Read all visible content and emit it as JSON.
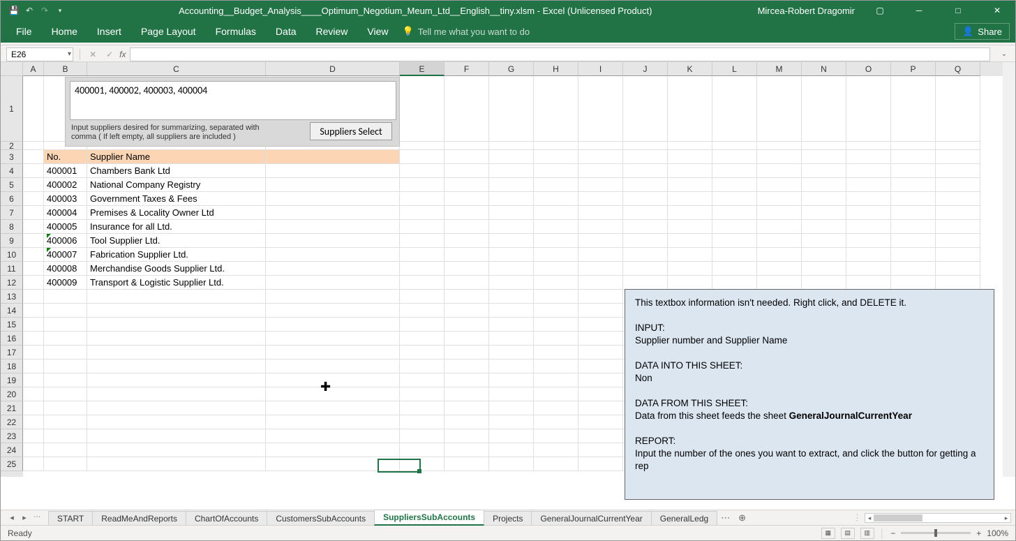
{
  "titlebar": {
    "title": "Accounting__Budget_Analysis____Optimum_Negotium_Meum_Ltd__English__tiny.xlsm  -  Excel (Unlicensed Product)",
    "user": "Mircea-Robert Dragomir"
  },
  "ribbon": {
    "tabs": [
      "File",
      "Home",
      "Insert",
      "Page Layout",
      "Formulas",
      "Data",
      "Review",
      "View"
    ],
    "tell_me": "Tell me what you want to do",
    "share": "Share"
  },
  "name_box": "E26",
  "columns": [
    "A",
    "B",
    "C",
    "D",
    "E",
    "F",
    "G",
    "H",
    "I",
    "J",
    "K",
    "L",
    "M",
    "N",
    "O",
    "P",
    "Q"
  ],
  "row_count": 25,
  "input_panel": {
    "value": "400001, 400002, 400003, 400004",
    "hint": "Input suppliers desired for summarizing, separated with comma ( If left empty, all suppliers are included )",
    "button": "Suppliers Select"
  },
  "table": {
    "headers": {
      "no": "No.",
      "name": "Supplier Name"
    },
    "rows": [
      {
        "no": "400001",
        "name": "Chambers Bank Ltd"
      },
      {
        "no": "400002",
        "name": "National Company Registry"
      },
      {
        "no": "400003",
        "name": "Government Taxes & Fees"
      },
      {
        "no": "400004",
        "name": "Premises & Locality Owner Ltd"
      },
      {
        "no": "400005",
        "name": "Insurance for all Ltd."
      },
      {
        "no": "400006",
        "name": "Tool Supplier Ltd."
      },
      {
        "no": "400007",
        "name": "Fabrication Supplier Ltd."
      },
      {
        "no": "400008",
        "name": "Merchandise Goods Supplier Ltd."
      },
      {
        "no": "400009",
        "name": "Transport & Logistic Supplier Ltd."
      }
    ]
  },
  "info_box": {
    "l1": "This textbox information isn't needed. Right click, and DELETE it.",
    "l2": "INPUT:",
    "l3": "Supplier number and Supplier Name",
    "l4": "DATA INTO THIS SHEET:",
    "l5": "Non",
    "l6": "DATA FROM THIS SHEET:",
    "l7a": "Data from this sheet feeds the sheet ",
    "l7b": "GeneralJournalCurrentYear",
    "l8": "REPORT:",
    "l9": "Input  the number of the ones you want to extract, and click the button for getting a rep"
  },
  "sheets": {
    "tabs": [
      "START",
      "ReadMeAndReports",
      "ChartOfAccounts",
      "CustomersSubAccounts",
      "SuppliersSubAccounts",
      "Projects",
      "GeneralJournalCurrentYear",
      "GeneralLedg"
    ],
    "active": "SuppliersSubAccounts"
  },
  "status": {
    "ready": "Ready",
    "zoom": "100%"
  }
}
